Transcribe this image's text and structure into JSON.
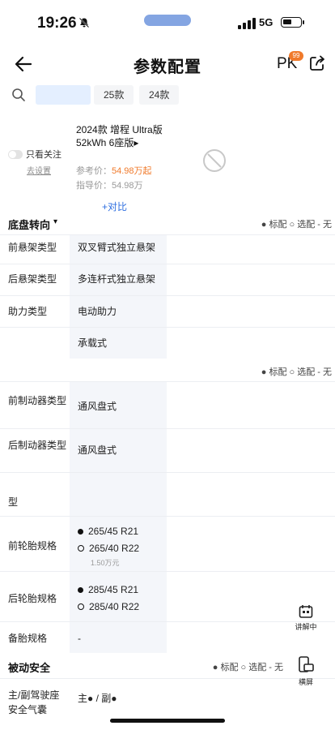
{
  "status_bar": {
    "time": "19:26",
    "network": "5G"
  },
  "nav": {
    "title": "参数配置",
    "pk_label": "PK",
    "pk_badge": "99"
  },
  "search": {
    "years": [
      "25款",
      "24款"
    ]
  },
  "filter": {
    "only_focus_label": "只看关注",
    "setting_link": "去设置"
  },
  "car": {
    "name": "2024款 增程 Ultra版 52kWh 6座版▸",
    "ref_price_label": "参考价：",
    "ref_price": "54.98万起",
    "guide_price_label": "指导价：",
    "guide_price": "54.98万",
    "compare_label": "+对比"
  },
  "legend": "● 标配  ○ 选配  - 无",
  "sections": {
    "chassis": {
      "title": "底盘转向",
      "caret": "▾"
    },
    "passive_safety": {
      "title": "被动安全"
    }
  },
  "rows": {
    "front_suspension": {
      "label": "前悬架类型",
      "value": "双叉臂式独立悬架"
    },
    "rear_suspension": {
      "label": "后悬架类型",
      "value": "多连杆式独立悬架"
    },
    "power_steering": {
      "label": "助力类型",
      "value": "电动助力"
    },
    "body_structure": {
      "label": "",
      "value": "承载式"
    },
    "front_brake": {
      "label": "前制动器类型",
      "value": "通风盘式"
    },
    "rear_brake": {
      "label": "后制动器类型",
      "value": "通风盘式"
    },
    "brake_type_partial": {
      "label": "型"
    },
    "front_tire": {
      "label": "前轮胎规格",
      "options": [
        "265/45 R21",
        "265/40 R22"
      ],
      "note": "1.50万元"
    },
    "rear_tire": {
      "label": "后轮胎规格",
      "options": [
        "285/45 R21",
        "285/40 R22"
      ]
    },
    "spare_tire": {
      "label": "备胎规格",
      "value": "-"
    },
    "airbag": {
      "label": "主/副驾驶座安全气囊",
      "value": "主● / 副●"
    }
  },
  "floating": {
    "explain_label": "讲解中",
    "landscape_label": "横屏"
  }
}
